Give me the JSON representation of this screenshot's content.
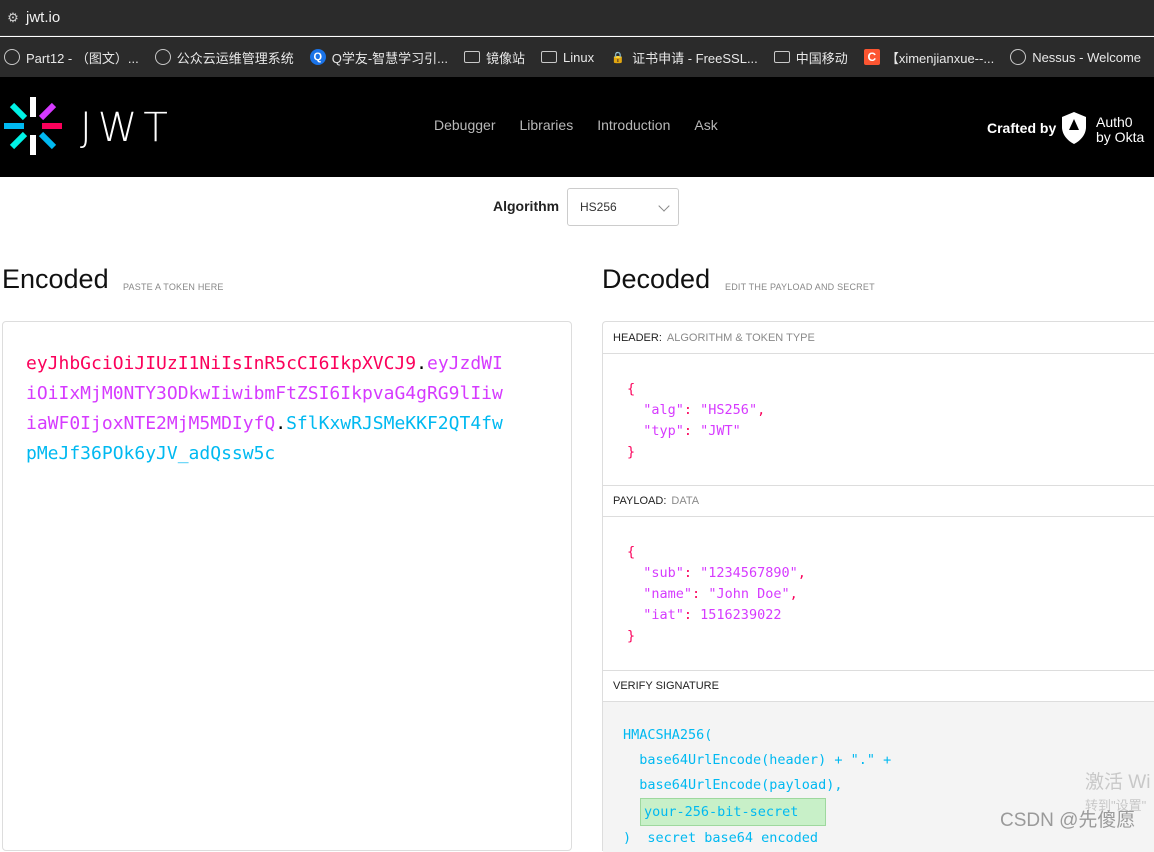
{
  "browser": {
    "url": "jwt.io",
    "bookmarks": [
      {
        "label": "Part12 - （图文）...",
        "icon": "globe-icon"
      },
      {
        "label": "公众云运维管理系统",
        "icon": "globe-icon"
      },
      {
        "label": "Q学友-智慧学习引...",
        "icon": "q-icon"
      },
      {
        "label": "镜像站",
        "icon": "folder-icon"
      },
      {
        "label": "Linux",
        "icon": "folder-icon"
      },
      {
        "label": "证书申请 - FreeSSL...",
        "icon": "lock-icon"
      },
      {
        "label": "中国移动",
        "icon": "folder-icon"
      },
      {
        "label": "【ximenjianxue--...",
        "icon": "csdn-icon"
      },
      {
        "label": "Nessus - Welcome",
        "icon": "globe-icon"
      }
    ]
  },
  "nav": {
    "wordmark": "JWT",
    "links": [
      "Debugger",
      "Libraries",
      "Introduction",
      "Ask"
    ],
    "crafted_by": "Crafted by",
    "auth0_line1": "Auth0",
    "auth0_line2": "by Okta"
  },
  "algorithm": {
    "label": "Algorithm",
    "selected": "HS256"
  },
  "encoded": {
    "title": "Encoded",
    "subtitle": "PASTE A TOKEN HERE",
    "header_part": "eyJhbGciOiJIUzI1NiIsInR5cCI6IkpXVCJ9",
    "payload_part": "eyJzdWIiOiIxMjM0NTY3ODkwIiwibmFtZSI6IkpvaG4gRG9lIiwiaWF0IjoxNTE2MjM5MDIyfQ",
    "signature_part": "SflKxwRJSMeKKF2QT4fwpMeJf36POk6yJV_adQssw5c",
    "dot": "."
  },
  "decoded": {
    "title": "Decoded",
    "subtitle": "EDIT THE PAYLOAD AND SECRET",
    "header_panel": {
      "label": "HEADER:",
      "sublabel": "ALGORITHM & TOKEN TYPE",
      "alg_key": "\"alg\"",
      "alg_value": "\"HS256\"",
      "typ_key": "\"typ\"",
      "typ_value": "\"JWT\""
    },
    "payload_panel": {
      "label": "PAYLOAD:",
      "sublabel": "DATA",
      "sub_key": "\"sub\"",
      "sub_value": "\"1234567890\"",
      "name_key": "\"name\"",
      "name_value": "\"John Doe\"",
      "iat_key": "\"iat\"",
      "iat_value": "1516239022"
    },
    "signature_panel": {
      "label": "VERIFY SIGNATURE",
      "line1": "HMACSHA256(",
      "line2": "  base64UrlEncode(header) + \".\" +",
      "line3": "  base64UrlEncode(payload),",
      "secret_placeholder": "your-256-bit-secret",
      "line5": ")  secret base64 encoded"
    }
  },
  "overlay": {
    "activate_windows": "激活 Wi",
    "activate_sub": "转到\"设置\"",
    "csdn": "CSDN @先傻愿"
  }
}
